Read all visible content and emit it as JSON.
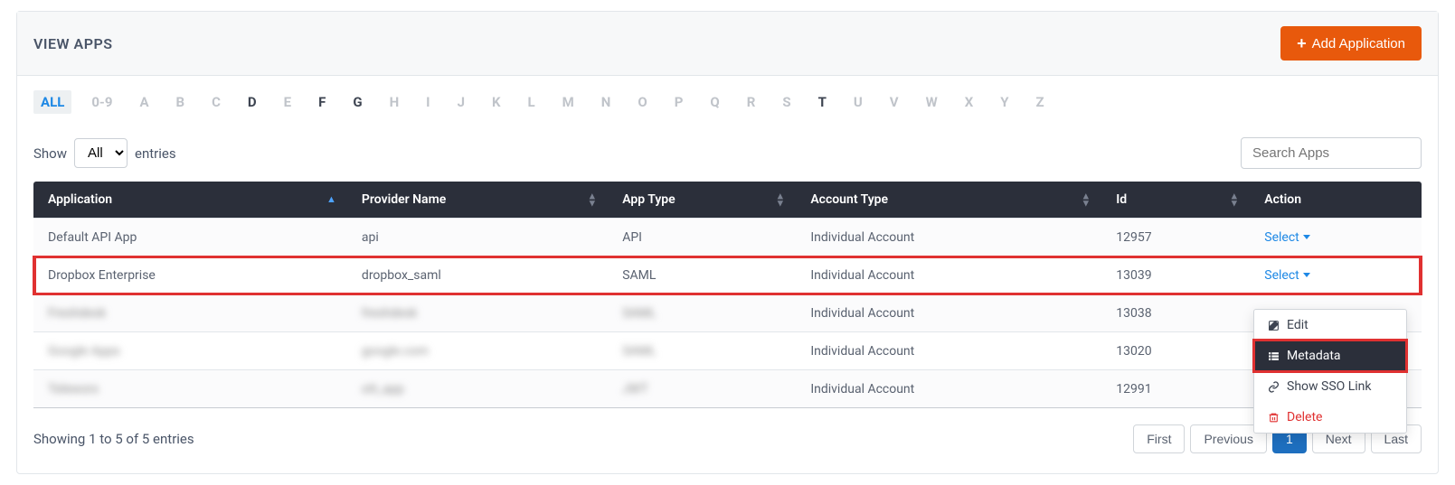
{
  "header": {
    "title": "VIEW APPS",
    "add_button": "Add Application"
  },
  "alpha_filter": {
    "items": [
      "ALL",
      "0-9",
      "A",
      "B",
      "C",
      "D",
      "E",
      "F",
      "G",
      "H",
      "I",
      "J",
      "K",
      "L",
      "M",
      "N",
      "O",
      "P",
      "Q",
      "R",
      "S",
      "T",
      "U",
      "V",
      "W",
      "X",
      "Y",
      "Z"
    ],
    "active": "ALL",
    "bold": [
      "D",
      "F",
      "G",
      "T"
    ]
  },
  "controls": {
    "show_label_before": "Show",
    "show_label_after": "entries",
    "show_value": "All",
    "search_placeholder": "Search Apps"
  },
  "table": {
    "columns": [
      "Application",
      "Provider Name",
      "App Type",
      "Account Type",
      "Id",
      "Action"
    ],
    "sort_column": 0,
    "sort_dir": "asc",
    "select_label": "Select",
    "rows": [
      {
        "app": "Default API App",
        "provider": "api",
        "type": "API",
        "account": "Individual Account",
        "id": "12957",
        "blur": false,
        "highlight": false
      },
      {
        "app": "Dropbox Enterprise",
        "provider": "dropbox_saml",
        "type": "SAML",
        "account": "Individual Account",
        "id": "13039",
        "blur": false,
        "highlight": true
      },
      {
        "app": "Freshdesk",
        "provider": "freshdesk",
        "type": "SAML",
        "account": "Individual Account",
        "id": "13038",
        "blur": true,
        "highlight": false
      },
      {
        "app": "Google Apps",
        "provider": "google.com",
        "type": "SAML",
        "account": "Individual Account",
        "id": "13020",
        "blur": true,
        "highlight": false
      },
      {
        "app": "Teleworx",
        "provider": "ott_app",
        "type": "JWT",
        "account": "Individual Account",
        "id": "12991",
        "blur": true,
        "highlight": false
      }
    ]
  },
  "footer": {
    "summary": "Showing 1 to 5 of 5 entries",
    "pages": [
      "First",
      "Previous",
      "1",
      "Next",
      "Last"
    ],
    "active_page": "1"
  },
  "dropdown": {
    "edit": "Edit",
    "metadata": "Metadata",
    "show_sso": "Show SSO Link",
    "delete": "Delete"
  }
}
